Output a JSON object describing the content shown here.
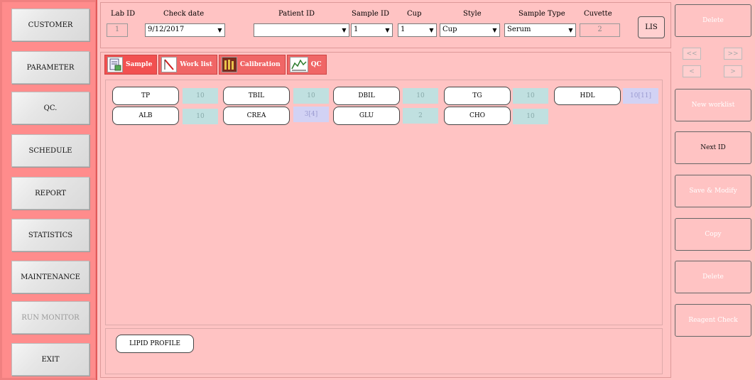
{
  "nav": {
    "customer": "CUSTOMER",
    "parameter": "PARAMETER",
    "qc": "QC.",
    "schedule": "SCHEDULE",
    "report": "REPORT",
    "statistics": "STATISTICS",
    "maintenance": "MAINTENANCE",
    "run_monitor": "RUN MONITOR",
    "exit": "EXIT"
  },
  "header": {
    "lab_id_label": "Lab ID",
    "lab_id_value": "1",
    "check_date_label": "Check date",
    "check_date_value": "9/12/2017",
    "patient_id_label": "Patient ID",
    "patient_id_value": "",
    "sample_id_label": "Sample ID",
    "sample_id_value": "1",
    "cup_label": "Cup",
    "cup_value": "1",
    "style_label": "Style",
    "style_value": "Cup",
    "sample_type_label": "Sample Type",
    "sample_type_value": "Serum",
    "cuvette_label": "Cuvette",
    "cuvette_value": "2",
    "lis_label": "LIS"
  },
  "tabs": {
    "sample": "Sample",
    "work_list": "Work list",
    "calibration": "Calibration",
    "qc": "QC"
  },
  "tests": {
    "tp": {
      "name": "TP",
      "value": "10"
    },
    "tbil": {
      "name": "TBIL",
      "value": "10"
    },
    "dbil": {
      "name": "DBIL",
      "value": "10"
    },
    "tg": {
      "name": "TG",
      "value": "10"
    },
    "hdl": {
      "name": "HDL",
      "value": "10[11]"
    },
    "alb": {
      "name": "ALB",
      "value": "10"
    },
    "crea": {
      "name": "CREA",
      "value": "3[4]"
    },
    "glu": {
      "name": "GLU",
      "value": "2"
    },
    "cho": {
      "name": "CHO",
      "value": "10"
    }
  },
  "profiles": {
    "lipid_profile": "LIPID PROFILE"
  },
  "right": {
    "delete_top": "Delete",
    "new_worklist": "New worklist",
    "next_id": "Next ID",
    "save_modify": "Save & Modify",
    "copy": "Copy",
    "delete": "Delete",
    "reagent_check": "Reagent Check",
    "page_first": "<<",
    "page_last": ">>",
    "page_prev": "<",
    "page_next": ">"
  },
  "colors": {
    "background": "#ffc3c3",
    "nav_frame": "#f08080",
    "tab": "#f06666",
    "test_value": "#c0e0e0",
    "test_value_alt": "#d2d2f4"
  }
}
